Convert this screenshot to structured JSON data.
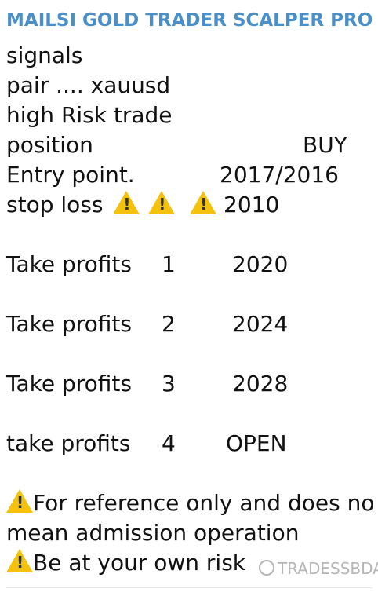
{
  "header": {
    "title": "MAILSI GOLD TRADER SCALPER PRO"
  },
  "signal": {
    "signals": "signals",
    "pair": "pair .... xauusd",
    "risk": "high  Risk  trade",
    "position_label": "position",
    "position_value": "BUY",
    "entry_label": "Entry point.",
    "entry_value": "2017/2016",
    "sl_label": "stop loss",
    "sl_value": "2010"
  },
  "take_profits": [
    {
      "label": "Take profits",
      "num": "1",
      "value": "2020"
    },
    {
      "label": "Take profits",
      "num": "2",
      "value": "2024"
    },
    {
      "label": "Take profits",
      "num": "3",
      "value": "2028"
    },
    {
      "label": "take profits",
      "num": "4",
      "value": "OPEN"
    }
  ],
  "disclaimer": {
    "line1": "For reference only and does no",
    "line2": "mean admission operation",
    "line3": "Be at your own risk"
  },
  "watermark": "TRADESSBDA",
  "icons": {
    "warning": "warning-icon",
    "watermark": "watermark-logo-icon"
  },
  "colors": {
    "title": "#4a8fc8",
    "warning": "#f4c20d"
  }
}
